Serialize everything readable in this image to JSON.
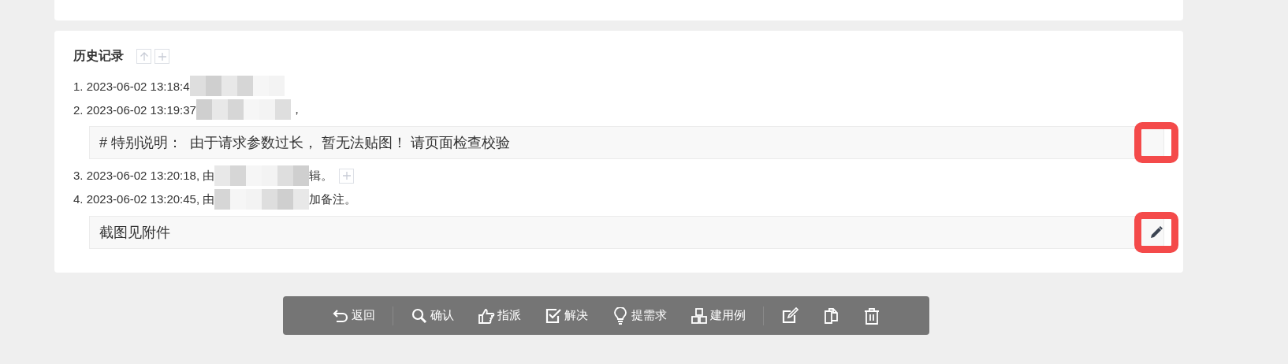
{
  "history": {
    "title": "历史记录",
    "header_buttons": [
      {
        "kind": "up"
      },
      {
        "kind": "plus"
      }
    ],
    "entries": [
      {
        "before": "1. 2023-06-02 13:18:4",
        "add_button": false
      },
      {
        "before": "2. 2023-06-02 13:19:37",
        "after": "，",
        "add_button": false,
        "note": {
          "text": "# 特别说明：  由于请求参数过长， 暂无法贴图！ 请页面检查校验",
          "highlighted": true,
          "edit_icon": false
        }
      },
      {
        "before": "3. 2023-06-02 13:20:18, 由",
        "after": "辑。",
        "add_button": true
      },
      {
        "before": "4. 2023-06-02 13:20:45, 由",
        "after": "加备注。",
        "add_button": false,
        "note": {
          "text": "截图见附件",
          "highlighted": true,
          "edit_icon": true
        }
      }
    ]
  },
  "toolbar_groups": [
    [
      {
        "kind": "back",
        "label": "返回"
      }
    ],
    [
      {
        "kind": "search",
        "label": "确认"
      },
      {
        "kind": "thumb",
        "label": "指派"
      },
      {
        "kind": "check",
        "label": "解决"
      },
      {
        "kind": "bulb",
        "label": "提需求"
      },
      {
        "kind": "blocks",
        "label": "建用例"
      }
    ],
    [
      {
        "kind": "edit"
      },
      {
        "kind": "copy"
      },
      {
        "kind": "trash"
      }
    ]
  ]
}
